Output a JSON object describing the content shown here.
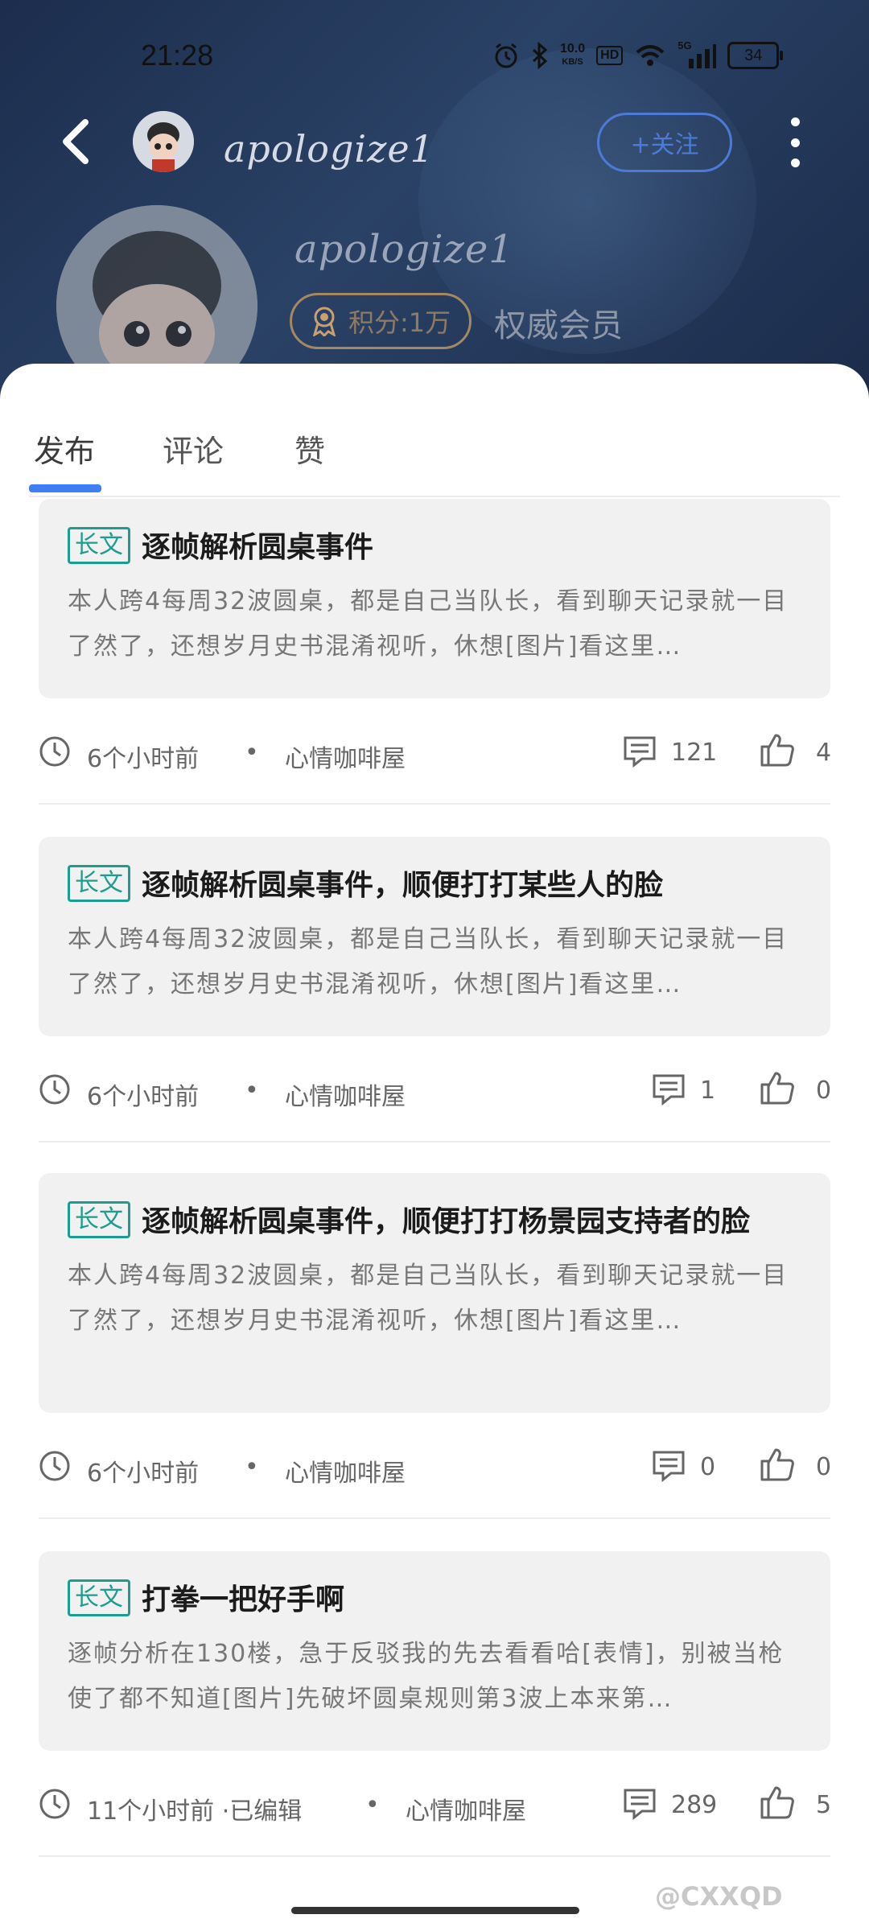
{
  "status_bar": {
    "time": "21:28",
    "network_speed": "10.0",
    "network_unit": "KB/S",
    "hd_label": "HD",
    "signal_label": "5G",
    "battery": "34"
  },
  "header": {
    "username": "apologize1",
    "follow_label": "+关注",
    "profile_name": "apologize1",
    "points_label": "积分:1万",
    "member_label": "权威会员"
  },
  "tabs": [
    {
      "label": "发布"
    },
    {
      "label": "评论"
    },
    {
      "label": "赞"
    }
  ],
  "posts": [
    {
      "tag": "长文",
      "title": "逐帧解析圆桌事件",
      "excerpt": "本人跨4每周32波圆桌，都是自己当队长，看到聊天记录就一目了然了，还想岁月史书混淆视听，休想[图片]看这里…",
      "time": "6个小时前",
      "dot": "•",
      "board": "心情咖啡屋",
      "comments": "121",
      "likes": "4"
    },
    {
      "tag": "长文",
      "title": "逐帧解析圆桌事件，顺便打打某些人的脸",
      "excerpt": "本人跨4每周32波圆桌，都是自己当队长，看到聊天记录就一目了然了，还想岁月史书混淆视听，休想[图片]看这里…",
      "time": "6个小时前",
      "dot": "•",
      "board": "心情咖啡屋",
      "comments": "1",
      "likes": "0"
    },
    {
      "tag": "长文",
      "title": "逐帧解析圆桌事件，顺便打打杨景园支持者的脸",
      "excerpt": "本人跨4每周32波圆桌，都是自己当队长，看到聊天记录就一目了然了，还想岁月史书混淆视听，休想[图片]看这里…",
      "time": "6个小时前",
      "dot": "•",
      "board": "心情咖啡屋",
      "comments": "0",
      "likes": "0"
    },
    {
      "tag": "长文",
      "title": "打拳一把好手啊",
      "excerpt": "逐帧分析在130楼，急于反驳我的先去看看哈[表情]，别被当枪使了都不知道[图片]先破坏圆桌规则第3波上本来第…",
      "time": "11个小时前 ·已编辑",
      "dot": "•",
      "board": "心情咖啡屋",
      "comments": "289",
      "likes": "5"
    }
  ],
  "watermark": "@CXXQD",
  "colors": {
    "accent": "#3f7ff4",
    "tag": "#1b9e8f",
    "follow": "#4b7bd6",
    "header_bg": "#1f3152"
  }
}
